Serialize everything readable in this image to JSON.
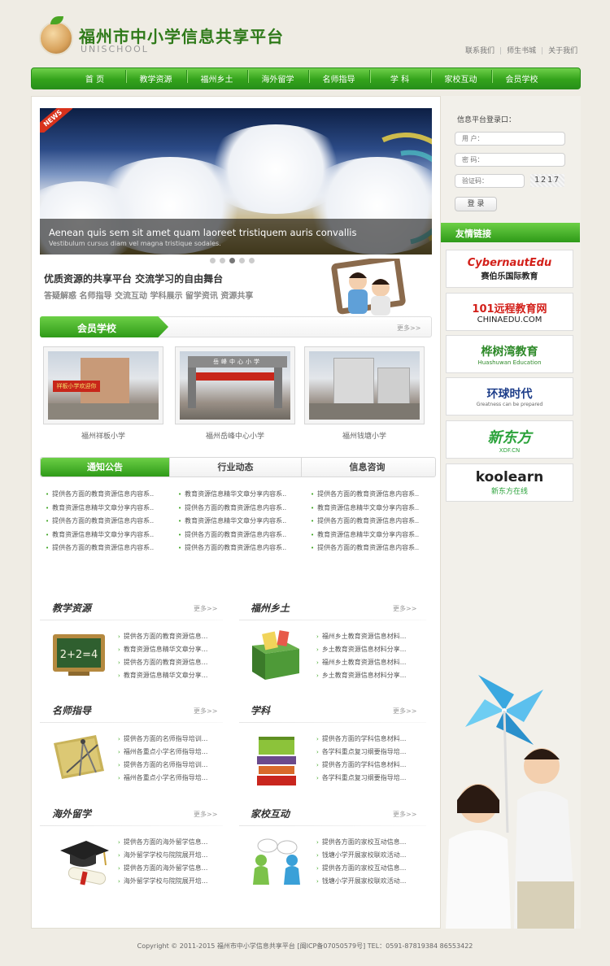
{
  "header": {
    "title": "福州市中小学信息共享平台",
    "subtitle": "UNISCHOOL",
    "links": [
      "联系我们",
      "师生书城",
      "关于我们"
    ]
  },
  "nav": [
    "首 页",
    "教学资源",
    "福州乡土",
    "海外留学",
    "名师指导",
    "学 科",
    "家校互动",
    "会员学校"
  ],
  "banner": {
    "tag": "NEWS",
    "title": "Aenean quis sem sit amet quam laoreet tristiquem auris convallis",
    "subtitle": "Vestibulum cursus diam vel magna tristique sodales.",
    "slides": 5,
    "active_slide": 3
  },
  "slogan": {
    "line1": "优质资源的共享平台 交流学习的自由舞台",
    "line2": "答疑解惑 名师指导 交流互动 学科展示 留学资讯 资源共享"
  },
  "member_schools": {
    "title": "会员学校",
    "more": "更多>>",
    "items": [
      "福州祥板小学",
      "福州岳峰中心小学",
      "福州钱塘小学"
    ],
    "sign_text": [
      "祥板小学欢迎你",
      "岳峰中心小学"
    ]
  },
  "tabs": {
    "labels": [
      "通知公告",
      "行业动态",
      "信息咨询"
    ],
    "columns": [
      [
        "提供各方面的教育资源信息内容系..",
        "教育资源信息精华文章分享内容系..",
        "提供各方面的教育资源信息内容系..",
        "教育资源信息精华文章分享内容系..",
        "提供各方面的教育资源信息内容系.."
      ],
      [
        "教育资源信息精华文章分享内容系..",
        "提供各方面的教育资源信息内容系..",
        "教育资源信息精华文章分享内容系..",
        "提供各方面的教育资源信息内容系..",
        "提供各方面的教育资源信息内容系.."
      ],
      [
        "提供各方面的教育资源信息内容系..",
        "教育资源信息精华文章分享内容系..",
        "提供各方面的教育资源信息内容系..",
        "教育资源信息精华文章分享内容系..",
        "提供各方面的教育资源信息内容系.."
      ]
    ]
  },
  "categories": [
    {
      "title": "教学资源",
      "more": "更多>>",
      "icon": "blackboard-icon",
      "board_text": "2+2=4",
      "items": [
        "提供各方面的教育资源信息...",
        "教育资源信息精华文章分享...",
        "提供各方面的教育资源信息...",
        "教育资源信息精华文章分享..."
      ]
    },
    {
      "title": "福州乡土",
      "more": "更多>>",
      "icon": "box-icon",
      "items": [
        "福州乡土教育资源信息材料...",
        "乡土教育资源信息材料分享...",
        "福州乡土教育资源信息材料...",
        "乡土教育资源信息材料分享..."
      ]
    },
    {
      "title": "名师指导",
      "more": "更多>>",
      "icon": "compass-icon",
      "items": [
        "提供各方面的名师指导培训...",
        "福州各重点小学名师指导培...",
        "提供各方面的名师指导培训...",
        "福州各重点小学名师指导培..."
      ]
    },
    {
      "title": "学科",
      "more": "更多>>",
      "icon": "books-icon",
      "items": [
        "提供各方面的学科信息材料...",
        "各学科重点复习纲要指导培...",
        "提供各方面的学科信息材料...",
        "各学科重点复习纲要指导培..."
      ]
    },
    {
      "title": "海外留学",
      "more": "更多>>",
      "icon": "graduation-cap-icon",
      "items": [
        "提供各方面的海外留学信息...",
        "海外留学学校与院院展开培...",
        "提供各方面的海外留学信息...",
        "海外留学学校与院院展开培..."
      ]
    },
    {
      "title": "家校互动",
      "more": "更多>>",
      "icon": "chat-people-icon",
      "items": [
        "提供各方面的家校互动信息...",
        "钱塘小学开展家校联欢活动...",
        "提供各方面的家校互动信息...",
        "钱塘小学开展家校联欢活动..."
      ]
    }
  ],
  "login": {
    "title": "信息平台登录口：",
    "user_placeholder": "用 户：",
    "password_placeholder": "密 码：",
    "captcha_placeholder": "验证码：",
    "captcha": "1217",
    "button": "登 录"
  },
  "friend_links": {
    "title": "友情链接",
    "items": [
      {
        "name": "CybernautEdu",
        "sub": "赛伯乐国际教育",
        "color": "#d3201a"
      },
      {
        "name": "101远程教育网",
        "sub": "CHINAEDU.COM",
        "color": "#d3201a"
      },
      {
        "name": "桦树湾教育",
        "sub": "Huashuwan Education",
        "color": "#2f8a2a"
      },
      {
        "name": "环球时代",
        "sub": "Greatness can be prepared",
        "color": "#1e3e8a"
      },
      {
        "name": "新东方",
        "sub": "XDF.CN",
        "color": "#2aa23a"
      },
      {
        "name": "koolearn",
        "sub": "新东方在线",
        "color": "#222222"
      }
    ]
  },
  "footer": "Copyright © 2011-2015 福州市中小学信息共享平台 [闽ICP备07050579号] TEL：0591-87819384 86553422",
  "colors": {
    "brand_green": "#34a31b",
    "title_green": "#2f7a1a",
    "accent_red": "#d3201a"
  }
}
